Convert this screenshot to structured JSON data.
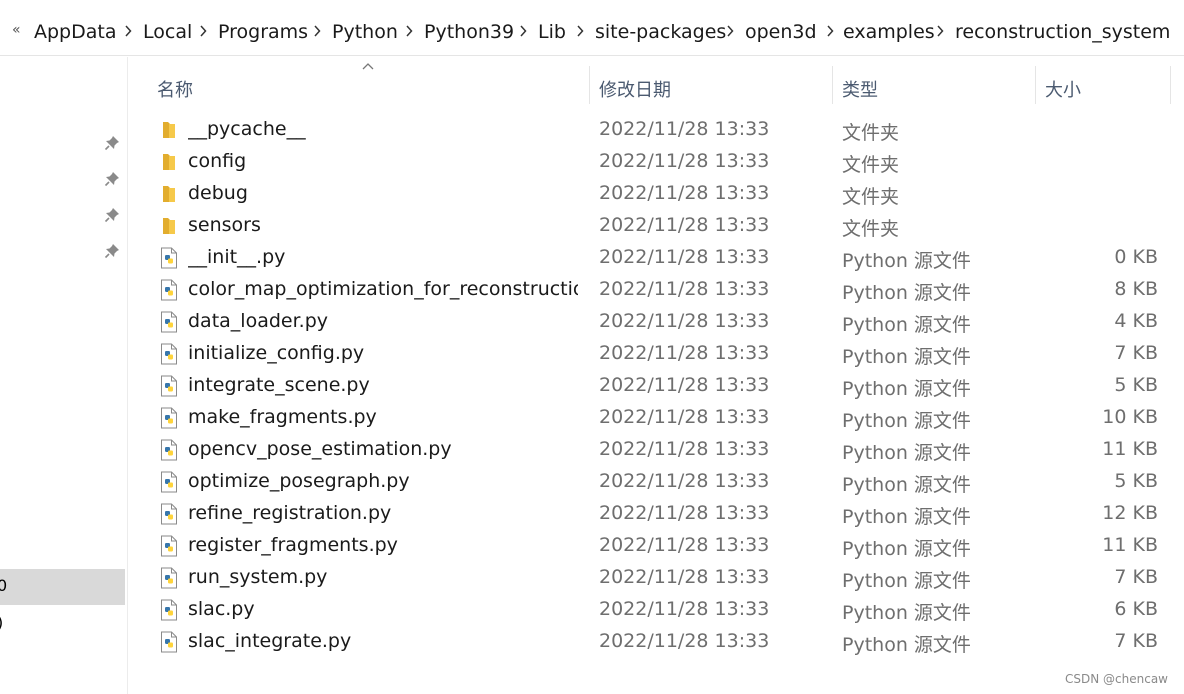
{
  "breadcrumb": {
    "back_glyph": "«",
    "segments": [
      "AppData",
      "Local",
      "Programs",
      "Python",
      "Python39",
      "Lib",
      "site-packages",
      "open3d",
      "examples",
      "reconstruction_system"
    ]
  },
  "columns": {
    "name": "名称",
    "date": "修改日期",
    "type": "类型",
    "size": "大小"
  },
  "nav": {
    "fragments": [
      "0",
      ")"
    ],
    "pin_icon": "pin-icon"
  },
  "files": [
    {
      "name": "__pycache__",
      "date": "2022/11/28 13:33",
      "type": "文件夹",
      "size": "",
      "icon": "folder-icon"
    },
    {
      "name": "config",
      "date": "2022/11/28 13:33",
      "type": "文件夹",
      "size": "",
      "icon": "folder-icon"
    },
    {
      "name": "debug",
      "date": "2022/11/28 13:33",
      "type": "文件夹",
      "size": "",
      "icon": "folder-icon"
    },
    {
      "name": "sensors",
      "date": "2022/11/28 13:33",
      "type": "文件夹",
      "size": "",
      "icon": "folder-icon"
    },
    {
      "name": "__init__.py",
      "date": "2022/11/28 13:33",
      "type": "Python 源文件",
      "size": "0 KB",
      "icon": "python-file-icon"
    },
    {
      "name": "color_map_optimization_for_reconstruction...",
      "date": "2022/11/28 13:33",
      "type": "Python 源文件",
      "size": "8 KB",
      "icon": "python-file-icon"
    },
    {
      "name": "data_loader.py",
      "date": "2022/11/28 13:33",
      "type": "Python 源文件",
      "size": "4 KB",
      "icon": "python-file-icon"
    },
    {
      "name": "initialize_config.py",
      "date": "2022/11/28 13:33",
      "type": "Python 源文件",
      "size": "7 KB",
      "icon": "python-file-icon"
    },
    {
      "name": "integrate_scene.py",
      "date": "2022/11/28 13:33",
      "type": "Python 源文件",
      "size": "5 KB",
      "icon": "python-file-icon"
    },
    {
      "name": "make_fragments.py",
      "date": "2022/11/28 13:33",
      "type": "Python 源文件",
      "size": "10 KB",
      "icon": "python-file-icon"
    },
    {
      "name": "opencv_pose_estimation.py",
      "date": "2022/11/28 13:33",
      "type": "Python 源文件",
      "size": "11 KB",
      "icon": "python-file-icon"
    },
    {
      "name": "optimize_posegraph.py",
      "date": "2022/11/28 13:33",
      "type": "Python 源文件",
      "size": "5 KB",
      "icon": "python-file-icon"
    },
    {
      "name": "refine_registration.py",
      "date": "2022/11/28 13:33",
      "type": "Python 源文件",
      "size": "12 KB",
      "icon": "python-file-icon"
    },
    {
      "name": "register_fragments.py",
      "date": "2022/11/28 13:33",
      "type": "Python 源文件",
      "size": "11 KB",
      "icon": "python-file-icon"
    },
    {
      "name": "run_system.py",
      "date": "2022/11/28 13:33",
      "type": "Python 源文件",
      "size": "7 KB",
      "icon": "python-file-icon"
    },
    {
      "name": "slac.py",
      "date": "2022/11/28 13:33",
      "type": "Python 源文件",
      "size": "6 KB",
      "icon": "python-file-icon"
    },
    {
      "name": "slac_integrate.py",
      "date": "2022/11/28 13:33",
      "type": "Python 源文件",
      "size": "7 KB",
      "icon": "python-file-icon"
    }
  ],
  "watermark": "CSDN @chencaw",
  "colors": {
    "folder": "#f6c94a",
    "python_blue": "#3776ab",
    "python_yellow": "#ffd43b",
    "selected_bg": "#d9d9d9",
    "header_text": "#4b5a70"
  }
}
